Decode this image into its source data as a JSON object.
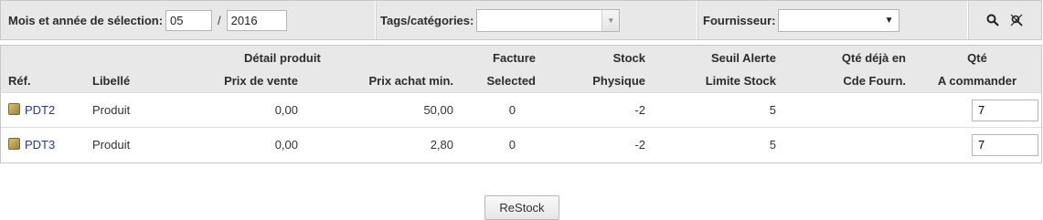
{
  "filters": {
    "month_year_label": "Mois et année de sélection:",
    "month_value": "05",
    "separator": "/",
    "year_value": "2016",
    "tags_label": "Tags/catégories:",
    "tags_value": "",
    "supplier_label": "Fournisseur:",
    "supplier_value": "",
    "search_icon": "search-icon",
    "clear_icon": "clear-filter-icon"
  },
  "table": {
    "group_headers": [
      "",
      "",
      "Détail produit",
      "",
      "Facture",
      "Stock",
      "Seuil Alerte",
      "Qté déjà en",
      "Qté"
    ],
    "columns": [
      "Réf.",
      "Libellé",
      "Prix de vente",
      "Prix achat min.",
      "Selected",
      "Physique",
      "Limite Stock",
      "Cde Fourn.",
      "A commander"
    ],
    "rows": [
      {
        "ref": "PDT2",
        "label": "Produit",
        "sell_price": "0,00",
        "min_buy_price": "50,00",
        "selected": "0",
        "physical": "-2",
        "limit": "5",
        "ordered": "",
        "to_order": "7"
      },
      {
        "ref": "PDT3",
        "label": "Produit",
        "sell_price": "0,00",
        "min_buy_price": "2,80",
        "selected": "0",
        "physical": "-2",
        "limit": "5",
        "ordered": "",
        "to_order": "7"
      }
    ]
  },
  "actions": {
    "restock_label": "ReStock"
  }
}
